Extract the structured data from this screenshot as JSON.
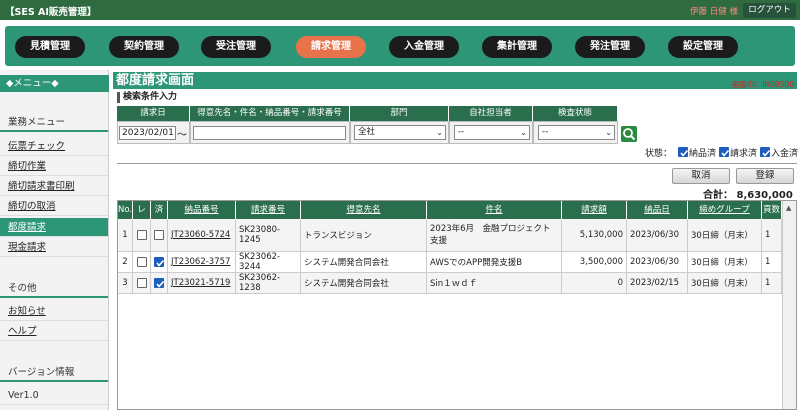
{
  "header": {
    "app_title": "【SES AI販売管理】",
    "user_name": "伊藤 日健 様",
    "logout_label": "ログアウト"
  },
  "nav": {
    "items": [
      {
        "label": "見積管理",
        "active": false
      },
      {
        "label": "契約管理",
        "active": false
      },
      {
        "label": "受注管理",
        "active": false
      },
      {
        "label": "請求管理",
        "active": true
      },
      {
        "label": "入金管理",
        "active": false
      },
      {
        "label": "集計管理",
        "active": false
      },
      {
        "label": "発注管理",
        "active": false
      },
      {
        "label": "設定管理",
        "active": false
      }
    ]
  },
  "sidebar": {
    "menu_header": "◆メニュー◆",
    "business_menu": "業務メニュー",
    "business_links": [
      "伝票チェック",
      "締切作業",
      "締切請求書印刷",
      "締切の取消",
      "都度請求",
      "現金請求"
    ],
    "active_link": "都度請求",
    "other_title": "その他",
    "other_links": [
      "お知らせ",
      "ヘルプ"
    ],
    "version_title": "バージョン情報",
    "version_value": "Ver1.0"
  },
  "main": {
    "page_title": "都度請求画面",
    "screen_id": "画面ID：IN00500",
    "sub_title": "検索条件入力",
    "conditions": {
      "headers": [
        "請求日",
        "得意先名・件名・納品番号・請求番号",
        "部門",
        "自社担当者",
        "検査状態"
      ],
      "date_value": "2023/02/01",
      "tilde": "～",
      "text_value": "",
      "department": "全社",
      "staff": "--",
      "inspection": "--"
    },
    "status": {
      "label": "状態：",
      "options": [
        {
          "label": "納品済",
          "checked": true
        },
        {
          "label": "請求済",
          "checked": true
        },
        {
          "label": "入金済",
          "checked": true
        }
      ]
    },
    "cancel_label": "取消",
    "register_label": "登録",
    "total_text": "合計： 8,630,000"
  },
  "table": {
    "columns": [
      "No.",
      "レ",
      "済",
      "納品番号",
      "請求番号",
      "得意先名",
      "件名",
      "請求額",
      "納品日",
      "締めグループ",
      "頁数"
    ],
    "rows": [
      {
        "no": "1",
        "check": false,
        "done": false,
        "delivery_no": "JT23060-5724",
        "invoice_no": "SK23080-1245",
        "customer": "トランスビジョン",
        "subject": "2023年6月　金融プロジェクト支援",
        "amount": "5,130,000",
        "delivery_date": "2023/06/30",
        "group": "30日締（月末）",
        "pages": "1"
      },
      {
        "no": "2",
        "check": false,
        "done": true,
        "delivery_no": "JT23062-3757",
        "invoice_no": "SK23062-3244",
        "customer": "システム開発合同会社",
        "subject": "AWSでのAPP開発支援B",
        "amount": "3,500,000",
        "delivery_date": "2023/06/30",
        "group": "30日締（月末）",
        "pages": "1"
      },
      {
        "no": "3",
        "check": false,
        "done": true,
        "delivery_no": "JT23021-5719",
        "invoice_no": "SK23062-1238",
        "customer": "システム開発合同会社",
        "subject": "Sin１ｗｄｆ",
        "amount": "0",
        "delivery_date": "2023/02/15",
        "group": "30日締（月末）",
        "pages": "1"
      }
    ]
  },
  "colors": {
    "nav_green": "#2c9676",
    "header_dark_green": "#2f6b3f",
    "table_header": "#2a6e4e",
    "active_nav": "#e8734a"
  }
}
